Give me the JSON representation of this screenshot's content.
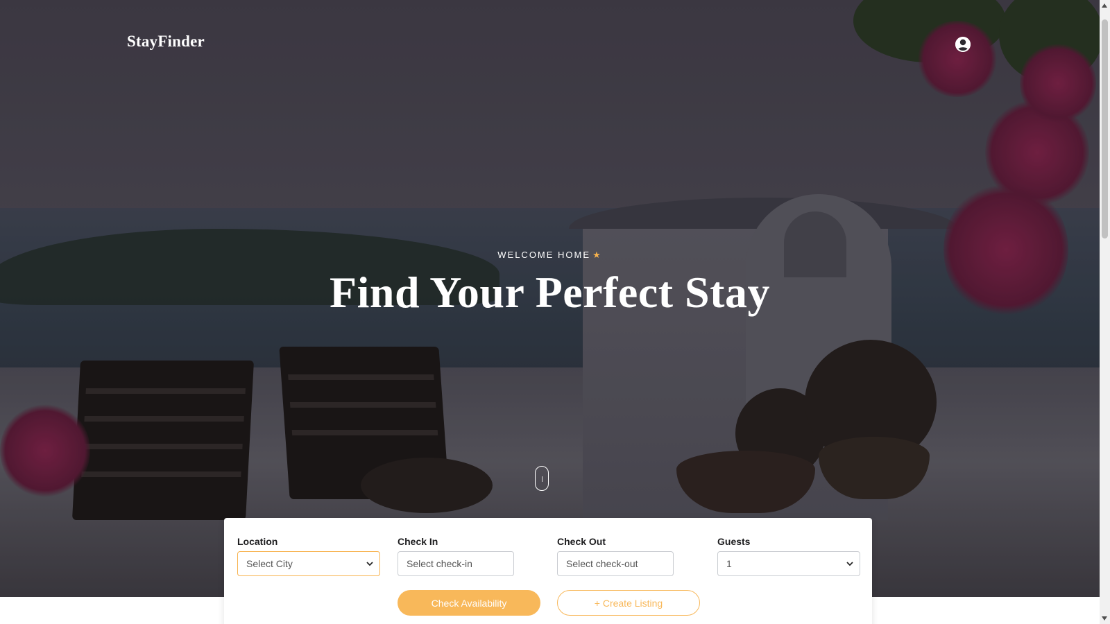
{
  "nav": {
    "brand": "StayFinder",
    "account_icon": "user-circle-icon"
  },
  "hero": {
    "eyebrow": "WELCOME HOME",
    "eyebrow_icon": "star-icon",
    "headline": "Find Your Perfect Stay",
    "scroll_icon": "mouse-scroll-icon"
  },
  "search": {
    "location": {
      "label": "Location",
      "value": "Select City"
    },
    "check_in": {
      "label": "Check In",
      "placeholder": "Select check-in"
    },
    "check_out": {
      "label": "Check Out",
      "placeholder": "Select check-out"
    },
    "guests": {
      "label": "Guests",
      "value": "1"
    },
    "check_availability_label": "Check Availability",
    "create_listing_label": "+ Create Listing"
  },
  "colors": {
    "accent": "#f8b85a",
    "hero_text": "#ffffff",
    "label_text": "#1d1d1f"
  }
}
